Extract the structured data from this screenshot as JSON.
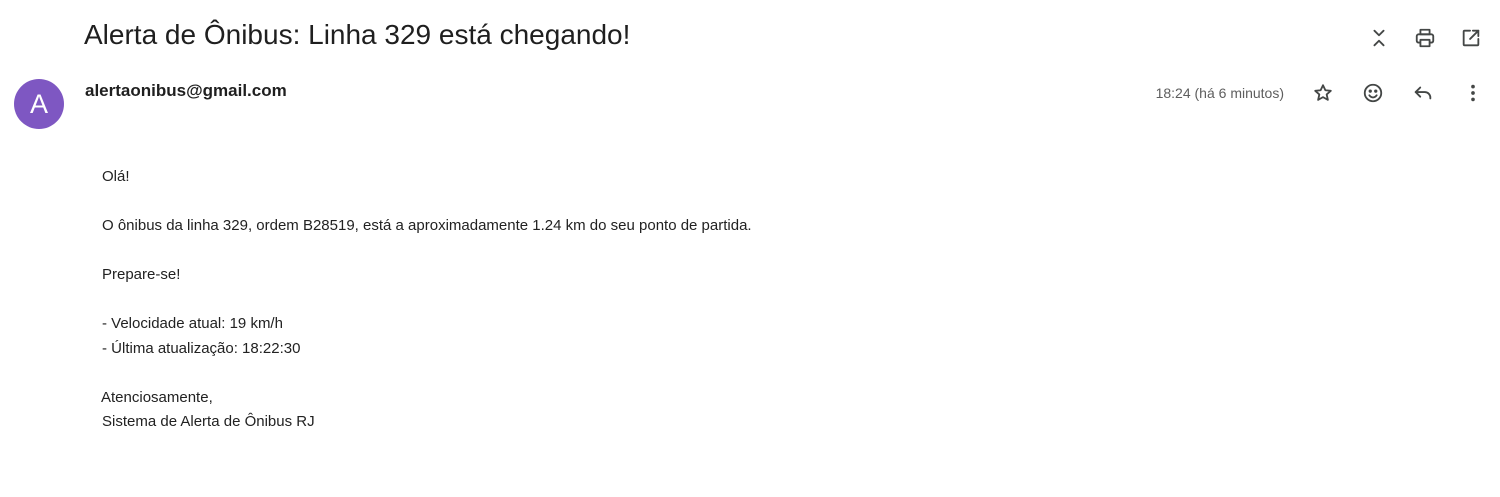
{
  "email": {
    "subject": "Alerta de Ônibus: Linha 329 está chegando!",
    "sender": "alertaonibus@gmail.com",
    "avatar_letter": "A",
    "avatar_color": "#7e57c2",
    "timestamp": "18:24 (há 6 minutos)",
    "body": {
      "greeting": "Olá!",
      "line1": "O ônibus da linha 329, ordem B28519, está a aproximadamente 1.24 km do seu ponto de partida.",
      "line2": "Prepare-se!",
      "speed": "- Velocidade atual: 19 km/h",
      "updated": "- Última atualização: 18:22:30",
      "closing": "Atenciosamente,",
      "signature": "Sistema de Alerta de Ônibus RJ"
    }
  },
  "icons": {
    "top": [
      "collapse-all-icon",
      "print-icon",
      "open-new-window-icon"
    ],
    "message": [
      "star-icon",
      "emoji-reaction-icon",
      "reply-icon",
      "more-vert-icon"
    ]
  }
}
